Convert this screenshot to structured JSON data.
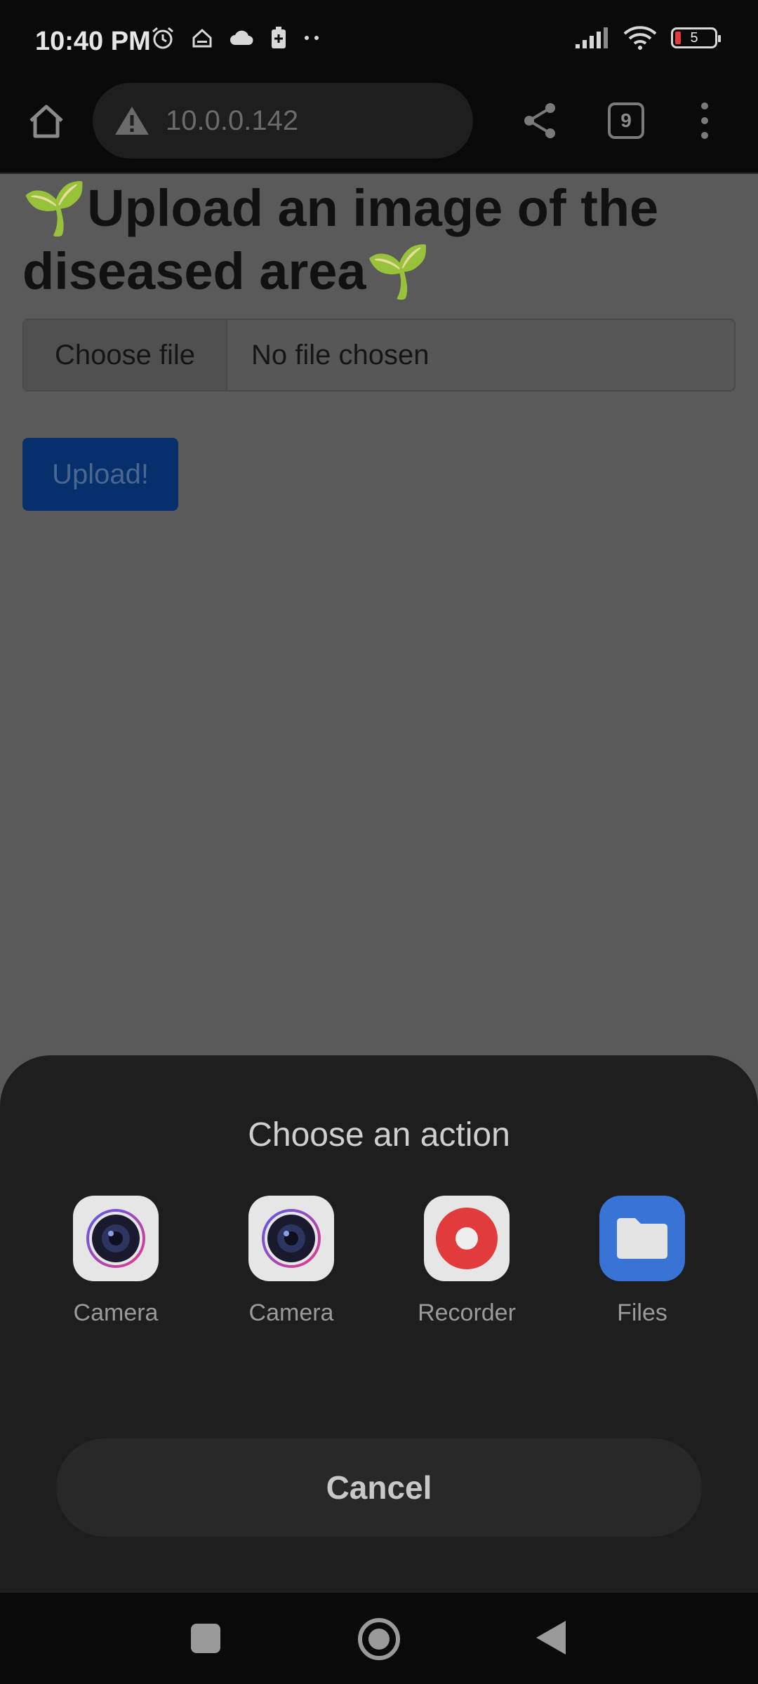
{
  "status_bar": {
    "time": "10:40 PM",
    "battery_level": "5"
  },
  "browser": {
    "url": "10.0.0.142",
    "tab_count": "9"
  },
  "page": {
    "title_prefix": "🌱",
    "title_text": "Upload an image of the diseased area",
    "title_suffix": "🌱",
    "file_button_label": "Choose file",
    "file_status": "No file chosen",
    "upload_button_label": "Upload!"
  },
  "sheet": {
    "title": "Choose an action",
    "apps": [
      {
        "label": "Camera",
        "icon": "camera-icon"
      },
      {
        "label": "Camera",
        "icon": "camera-icon"
      },
      {
        "label": "Recorder",
        "icon": "recorder-icon"
      },
      {
        "label": "Files",
        "icon": "folder-icon"
      }
    ],
    "cancel_label": "Cancel"
  },
  "colors": {
    "upload_button": "#062f6b",
    "recorder_red": "#e23b3b",
    "files_blue": "#3a73d6"
  }
}
